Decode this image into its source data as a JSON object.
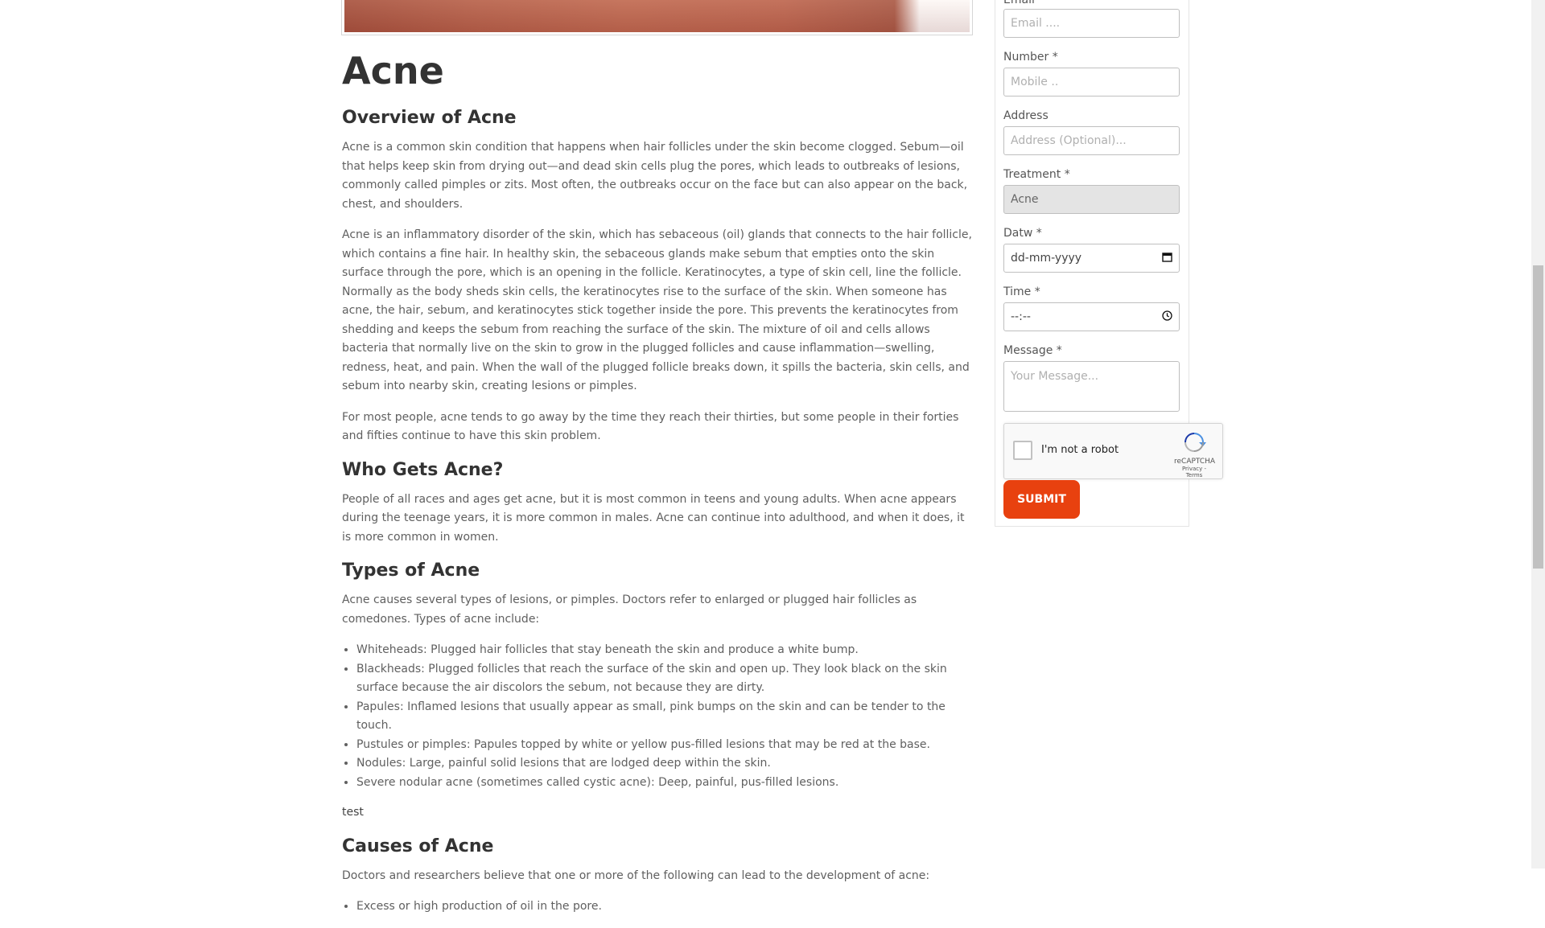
{
  "article": {
    "title": "Acne",
    "sections": {
      "overview": {
        "heading": "Overview of Acne",
        "paras": [
          "Acne is a common skin condition that happens when hair follicles under the skin become clogged. Sebum—oil that helps keep skin from drying out—and dead skin cells plug the pores, which leads to outbreaks of lesions, commonly called pimples or zits. Most often, the outbreaks occur on the face but can also appear on the back, chest, and shoulders.",
          "Acne is an inflammatory disorder of the skin, which has sebaceous (oil) glands that connects to the hair follicle, which contains a fine hair. In healthy skin, the sebaceous glands make sebum that empties onto the skin surface through the pore, which is an opening in the follicle. Keratinocytes, a type of skin cell, line the follicle.  Normally as the body sheds skin cells, the keratinocytes rise to the surface of the skin. When someone has acne, the hair, sebum, and keratinocytes stick together inside the pore. This prevents the keratinocytes from shedding and keeps the sebum from reaching the surface of the skin. The mixture of oil and cells allows bacteria that normally live on the skin to grow in the plugged follicles and cause inflammation—swelling, redness, heat, and pain. When the wall of the plugged follicle breaks down, it spills the bacteria, skin cells, and sebum into nearby skin, creating lesions or pimples.",
          "For most people, acne tends to go away by the time they reach their thirties, but some people in their forties and fifties continue to have this skin problem."
        ]
      },
      "who": {
        "heading": "Who Gets Acne?",
        "paras": [
          "People of all races and ages get acne, but it is most common in teens and young adults. When acne appears during the teenage years, it is more common in males. Acne can continue into adulthood, and when it does, it is more common in women."
        ]
      },
      "types": {
        "heading": "Types of Acne",
        "intro": "Acne causes several types of lesions, or pimples. Doctors refer to enlarged or plugged hair follicles as comedones. Types of acne include:",
        "items": [
          "Whiteheads: Plugged hair follicles that stay beneath the skin and produce a white bump.",
          "Blackheads: Plugged follicles that reach the surface of the skin and open up. They look black on the skin surface because the air discolors the sebum, not because they are dirty.",
          "Papules: Inflamed lesions that usually appear as small, pink bumps on the skin and can be tender to the touch.",
          "Pustules or pimples: Papules topped by white or yellow pus-filled lesions that may be red at the base.",
          "Nodules: Large, painful solid lesions that are lodged deep within the skin.",
          "Severe nodular acne (sometimes called cystic acne): Deep, painful, pus-filled lesions."
        ],
        "note": "test"
      },
      "causes": {
        "heading": "Causes of Acne",
        "intro": "Doctors and researchers believe that one or more of the following can lead to the development of acne:",
        "items": [
          "Excess or high production of oil in the pore."
        ]
      }
    }
  },
  "form": {
    "email": {
      "label": "Email",
      "placeholder": "Email ...."
    },
    "number": {
      "label": "Number *",
      "placeholder": "Mobile .."
    },
    "address": {
      "label": "Address",
      "placeholder": "Address (Optional)..."
    },
    "treatment": {
      "label": "Treatment *",
      "value": "Acne"
    },
    "date": {
      "label": "Datw *",
      "value": "dd-mm-yyyy"
    },
    "time": {
      "label": "Time *",
      "value": "--:--"
    },
    "message": {
      "label": "Message *",
      "placeholder": "Your Message..."
    },
    "captcha": {
      "label": "I'm not a robot",
      "brand": "reCAPTCHA",
      "links": "Privacy - Terms"
    },
    "submit_label": "SUBMIT"
  },
  "colors": {
    "accent": "#e8410f",
    "heading": "#333333",
    "body_text": "#606060"
  }
}
